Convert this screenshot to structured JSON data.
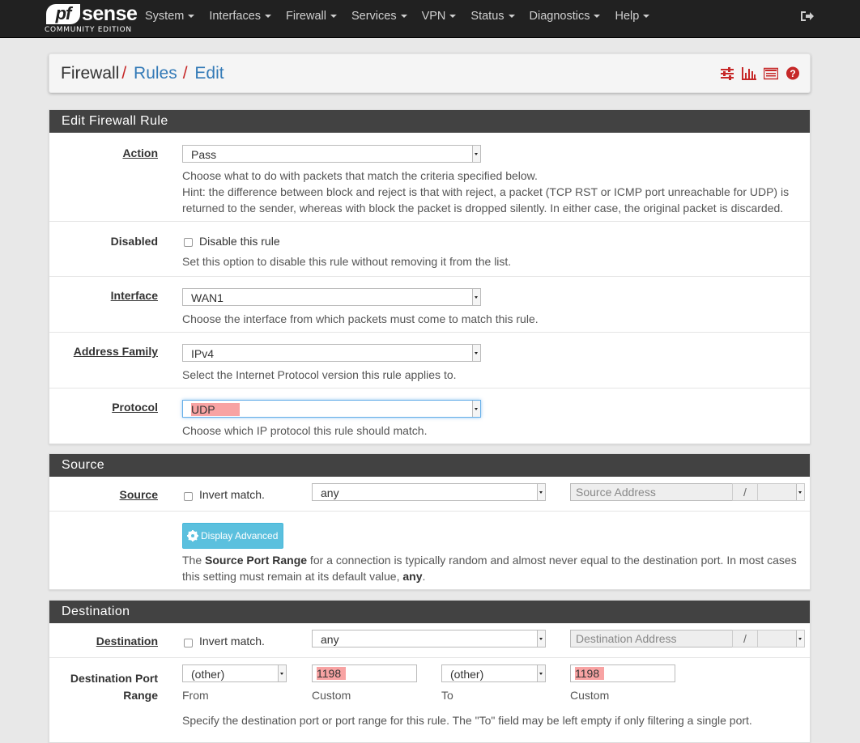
{
  "brand": {
    "logo_pf": "pf",
    "logo_sense": "sense",
    "edition": "COMMUNITY EDITION"
  },
  "nav": {
    "items": [
      {
        "label": "System"
      },
      {
        "label": "Interfaces"
      },
      {
        "label": "Firewall"
      },
      {
        "label": "Services"
      },
      {
        "label": "VPN"
      },
      {
        "label": "Status"
      },
      {
        "label": "Diagnostics"
      },
      {
        "label": "Help"
      }
    ],
    "logout_icon": "sign-out-icon"
  },
  "breadcrumb": {
    "first": "Firewall",
    "second": "Rules",
    "third": "Edit",
    "sep": "/",
    "icons": [
      "sliders-icon",
      "bar-chart-icon",
      "list-icon",
      "question-circle-icon"
    ]
  },
  "colors": {
    "accent_red": "#c62828",
    "link_blue": "#337ab7",
    "panel_heading": "#424242",
    "highlight": "#f8a3a3",
    "info_button": "#5bc0de"
  },
  "edit_panel": {
    "title": "Edit Firewall Rule",
    "action": {
      "label": "Action",
      "value": "Pass",
      "help1": "Choose what to do with packets that match the criteria specified below.",
      "help2": "Hint: the difference between block and reject is that with reject, a packet (TCP RST or ICMP port unreachable for UDP) is",
      "help3": "returned to the sender, whereas with block the packet is dropped silently. In either case, the original packet is discarded."
    },
    "disabled": {
      "label": "Disabled",
      "checkbox_label": "Disable this rule",
      "help": "Set this option to disable this rule without removing it from the list."
    },
    "interface": {
      "label": "Interface",
      "value": "WAN1",
      "help": "Choose the interface from which packets must come to match this rule."
    },
    "address_family": {
      "label": "Address Family",
      "value": "IPv4",
      "help": "Select the Internet Protocol version this rule applies to."
    },
    "protocol": {
      "label": "Protocol",
      "value": "UDP",
      "help": "Choose which IP protocol this rule should match."
    }
  },
  "source_panel": {
    "title": "Source",
    "label": "Source",
    "invert_label": "Invert match.",
    "type_value": "any",
    "address_placeholder": "Source Address",
    "slash": "/",
    "advanced_button": "Display Advanced",
    "help_pre": "The ",
    "help_bold": "Source Port Range",
    "help_mid": " for a connection is typically random and almost never equal to the destination port. In most cases",
    "help_line2_pre": "this setting must remain at its default value, ",
    "help_line2_bold": "any",
    "help_line2_post": "."
  },
  "destination_panel": {
    "title": "Destination",
    "label": "Destination",
    "invert_label": "Invert match.",
    "type_value": "any",
    "address_placeholder": "Destination Address",
    "slash": "/",
    "port_range_label_1": "Destination Port",
    "port_range_label_2": "Range",
    "from_select": "(other)",
    "from_custom": "1198",
    "to_select": "(other)",
    "to_custom": "1198",
    "from_label": "From",
    "custom_label": "Custom",
    "to_label": "To",
    "custom_label_2": "Custom",
    "help": "Specify the destination port or port range for this rule. The \"To\" field may be left empty if only filtering a single port."
  }
}
